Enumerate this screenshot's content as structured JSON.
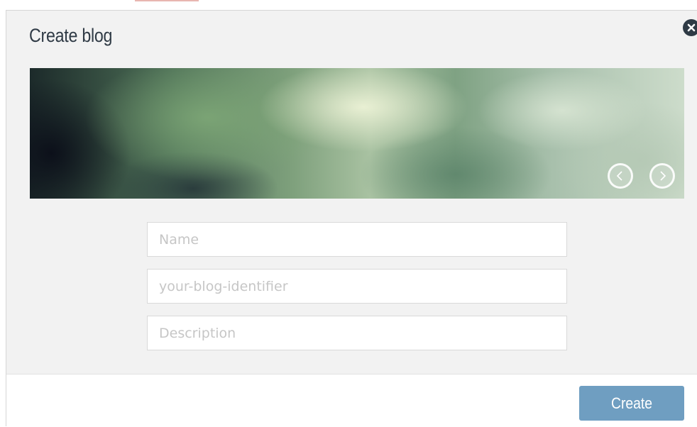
{
  "dialog": {
    "title": "Create blog",
    "close_icon": "close-icon"
  },
  "cover": {
    "prev_icon": "chevron-left-icon",
    "next_icon": "chevron-right-icon"
  },
  "form": {
    "name": {
      "placeholder": "Name",
      "value": ""
    },
    "identifier": {
      "placeholder": "your-blog-identifier",
      "value": ""
    },
    "description": {
      "placeholder": "Description",
      "value": ""
    }
  },
  "footer": {
    "create_label": "Create"
  },
  "colors": {
    "title_text": "#2f3a45",
    "dialog_background": "#f2f2f2",
    "primary_button": "#6f9ec1",
    "placeholder_text": "#c6c6c6"
  }
}
